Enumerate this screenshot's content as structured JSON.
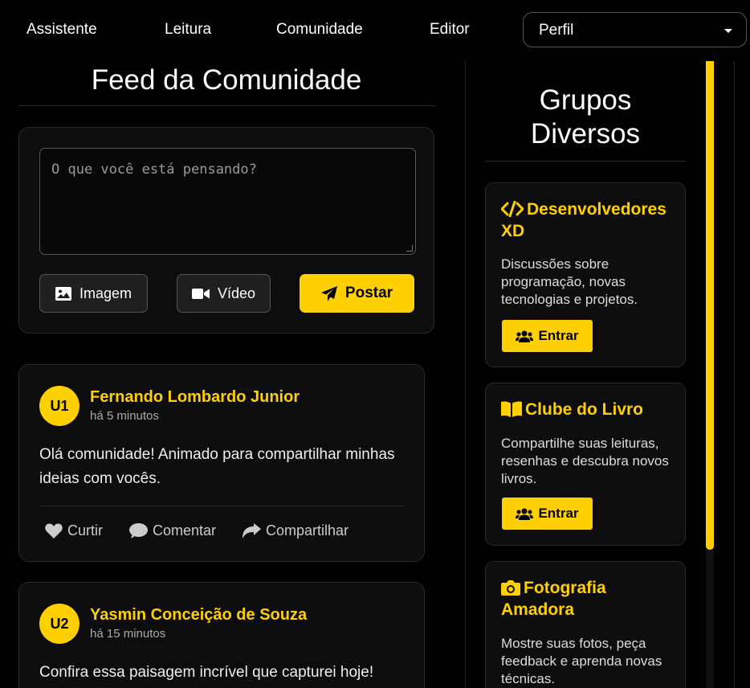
{
  "nav": {
    "links": [
      "Assistente",
      "Leitura",
      "Comunidade",
      "Editor"
    ],
    "profile_select": "Perfil"
  },
  "feed": {
    "title": "Feed da Comunidade",
    "composer": {
      "placeholder": "O que você está pensando?",
      "image_label": "Imagem",
      "video_label": "Vídeo",
      "post_label": "Postar"
    },
    "posts": [
      {
        "avatar": "U1",
        "author": "Fernando Lombardo Junior",
        "time": "há 5 minutos",
        "text": "Olá comunidade! Animado para compartilhar minhas ideias com vocês.",
        "like": "Curtir",
        "comment": "Comentar",
        "share": "Compartilhar"
      },
      {
        "avatar": "U2",
        "author": "Yasmin Conceição de Souza",
        "time": "há 15 minutos",
        "text": "Confira essa paisagem incrível que capturei hoje!"
      }
    ]
  },
  "sidebar": {
    "title": "Grupos Diversos",
    "groups": [
      {
        "icon": "code-icon",
        "name": "Desenvolvedores XD",
        "description": "Discussões sobre programação, novas tecnologias e projetos.",
        "join": "Entrar"
      },
      {
        "icon": "book-icon",
        "name": "Clube do Livro",
        "description": "Compartilhe suas leituras, resenhas e descubra novos livros.",
        "join": "Entrar"
      },
      {
        "icon": "camera-icon",
        "name": "Fotografia Amadora",
        "description": "Mostre suas fotos, peça feedback e aprenda novas técnicas."
      }
    ]
  },
  "colors": {
    "accent": "#ffd000",
    "background": "#000000",
    "card": "#0d0d0d",
    "border": "#2a2a2a"
  }
}
